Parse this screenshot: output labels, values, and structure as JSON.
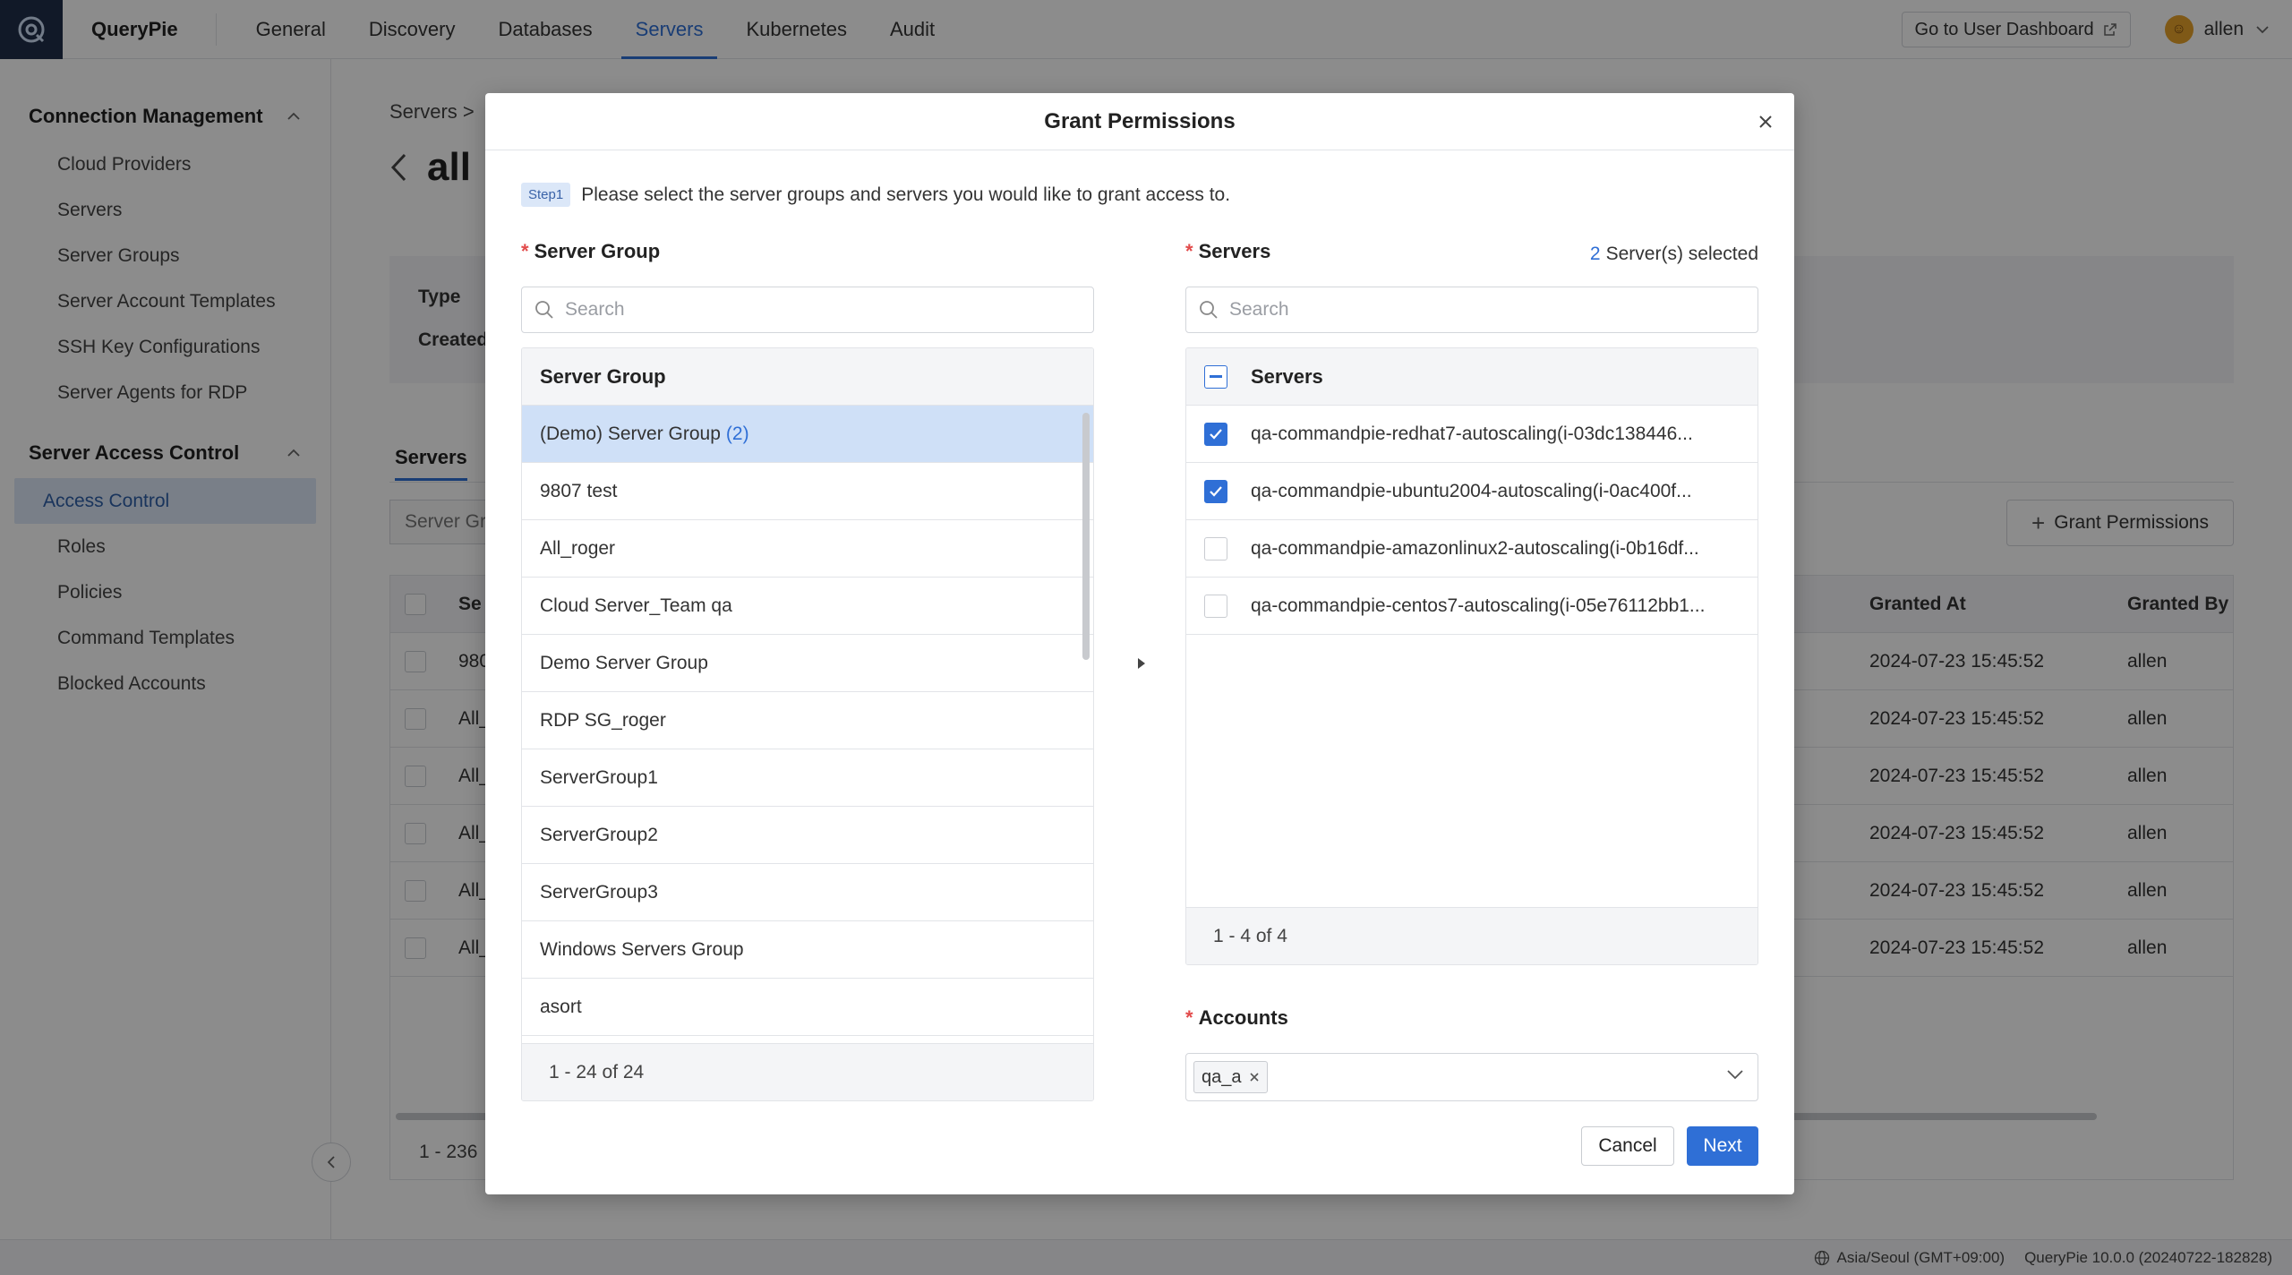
{
  "app": {
    "brand": "QueryPie"
  },
  "nav": {
    "items": [
      {
        "label": "General"
      },
      {
        "label": "Discovery"
      },
      {
        "label": "Databases"
      },
      {
        "label": "Servers"
      },
      {
        "label": "Kubernetes"
      },
      {
        "label": "Audit"
      }
    ],
    "dashboard_label": "Go to User Dashboard",
    "user": "allen"
  },
  "sidebar": {
    "sections": [
      {
        "title": "Connection Management",
        "items": [
          {
            "label": "Cloud Providers"
          },
          {
            "label": "Servers"
          },
          {
            "label": "Server Groups"
          },
          {
            "label": "Server Account Templates"
          },
          {
            "label": "SSH Key Configurations"
          },
          {
            "label": "Server Agents for RDP"
          }
        ]
      },
      {
        "title": "Server Access Control",
        "items": [
          {
            "label": "Access Control"
          },
          {
            "label": "Roles"
          },
          {
            "label": "Policies"
          },
          {
            "label": "Command Templates"
          },
          {
            "label": "Blocked Accounts"
          }
        ]
      }
    ]
  },
  "background": {
    "breadcrumb": "Servers",
    "title": "all",
    "info": {
      "type_label": "Type",
      "created_label": "Created"
    },
    "tab": "Servers",
    "filter_text": "Server Gr",
    "grant_button": "Grant Permissions",
    "columns": {
      "name": "Se",
      "granted_at": "Granted At",
      "granted_by": "Granted By"
    },
    "rows": [
      {
        "name": "980",
        "granted_at": "2024-07-23 15:45:52",
        "granted_by": "allen"
      },
      {
        "name": "All_",
        "granted_at": "2024-07-23 15:45:52",
        "granted_by": "allen"
      },
      {
        "name": "All_",
        "granted_at": "2024-07-23 15:45:52",
        "granted_by": "allen"
      },
      {
        "name": "All_",
        "granted_at": "2024-07-23 15:45:52",
        "granted_by": "allen"
      },
      {
        "name": "All_",
        "granted_at": "2024-07-23 15:45:52",
        "granted_by": "allen"
      },
      {
        "name": "All_",
        "granted_at": "2024-07-23 15:45:52",
        "granted_by": "allen"
      }
    ],
    "pager": "1 - 236"
  },
  "status_bar": {
    "timezone": "Asia/Seoul (GMT+09:00)",
    "version": "QueryPie 10.0.0 (20240722-182828)"
  },
  "modal": {
    "title": "Grant Permissions",
    "step_badge": "Step1",
    "step_text": "Please select the server groups and servers you would like to grant access to.",
    "server_group": {
      "label": "Server Group",
      "search_placeholder": "Search",
      "header": "Server Group",
      "items": [
        {
          "name": "(Demo) Server Group",
          "count": "(2)",
          "selected": true
        },
        {
          "name": "9807 test",
          "count": ""
        },
        {
          "name": "All_roger",
          "count": ""
        },
        {
          "name": "Cloud Server_Team qa",
          "count": ""
        },
        {
          "name": "Demo Server Group",
          "count": ""
        },
        {
          "name": "RDP SG_roger",
          "count": ""
        },
        {
          "name": "ServerGroup1",
          "count": ""
        },
        {
          "name": "ServerGroup2",
          "count": ""
        },
        {
          "name": "ServerGroup3",
          "count": ""
        },
        {
          "name": "Windows Servers Group",
          "count": ""
        },
        {
          "name": "asort",
          "count": ""
        }
      ],
      "footer": "1 - 24 of 24"
    },
    "servers": {
      "label": "Servers",
      "selected_count": "2",
      "selected_suffix": "Server(s) selected",
      "search_placeholder": "Search",
      "header": "Servers",
      "items": [
        {
          "name": "qa-commandpie-redhat7-autoscaling(i-03dc138446...",
          "checked": true
        },
        {
          "name": "qa-commandpie-ubuntu2004-autoscaling(i-0ac400f...",
          "checked": true
        },
        {
          "name": "qa-commandpie-amazonlinux2-autoscaling(i-0b16df...",
          "checked": false
        },
        {
          "name": "qa-commandpie-centos7-autoscaling(i-05e76112bb1...",
          "checked": false
        }
      ],
      "footer": "1 - 4 of 4"
    },
    "accounts": {
      "label": "Accounts",
      "tags": [
        "qa_a"
      ]
    },
    "cancel_label": "Cancel",
    "next_label": "Next"
  },
  "colors": {
    "accent": "#2f6fd6",
    "selected_row": "#cfe0f7",
    "overlay": "rgba(0,0,0,0.45)"
  }
}
